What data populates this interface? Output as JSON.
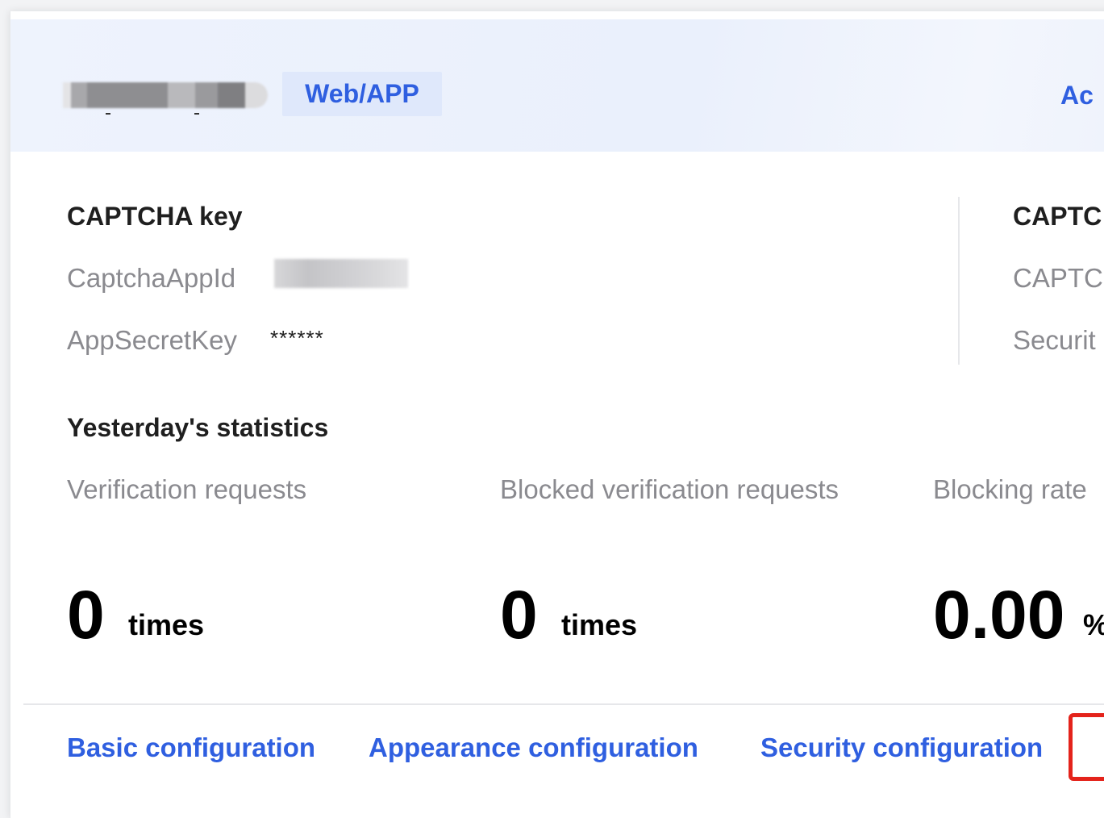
{
  "header": {
    "platform_tag": "Web/APP",
    "action_link": "Ac"
  },
  "captcha_key": {
    "title": "CAPTCHA key",
    "app_id_label": "CaptchaAppId",
    "secret_key_label": "AppSecretKey",
    "secret_key_value": "******"
  },
  "captcha_right": {
    "title": "CAPTC",
    "row1_label": "CAPTC",
    "row2_label": "Securit"
  },
  "statistics": {
    "title": "Yesterday's statistics",
    "items": [
      {
        "label": "Verification requests",
        "value": "0",
        "unit": "times"
      },
      {
        "label": "Blocked verification requests",
        "value": "0",
        "unit": "times"
      },
      {
        "label": "Blocking rate",
        "value": "0.00",
        "unit": "%"
      }
    ]
  },
  "footer": {
    "links": [
      "Basic configuration",
      "Appearance configuration",
      "Security configuration"
    ]
  },
  "colors": {
    "accent": "#2f5fe0",
    "highlight": "#e4231b",
    "muted_text": "#8a8a8f"
  }
}
